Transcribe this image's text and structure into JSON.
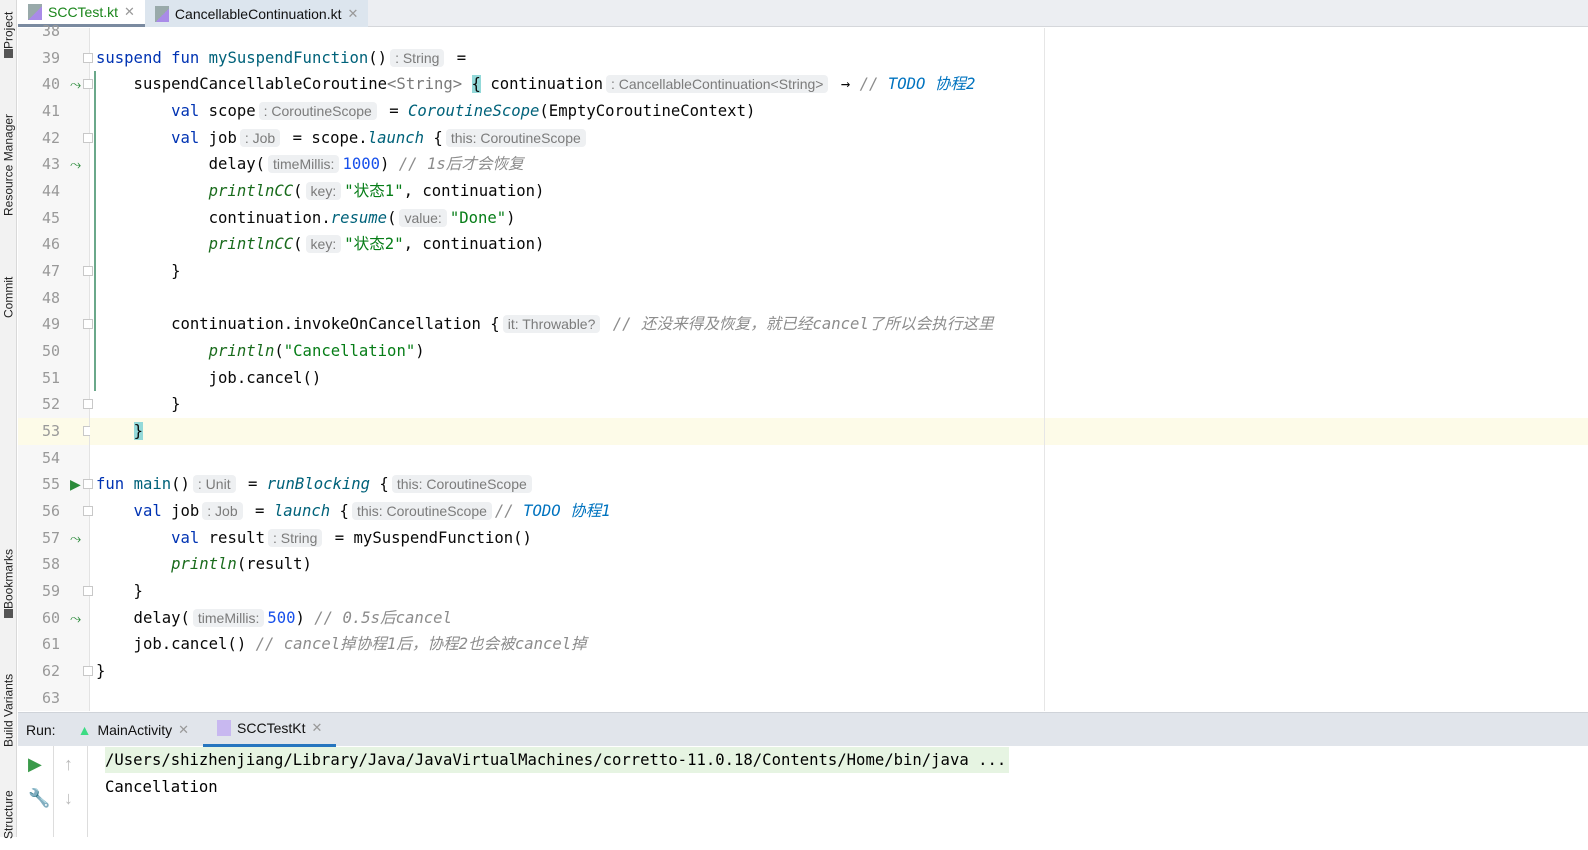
{
  "left_toolbar": [
    "Project",
    "Resource Manager",
    "Commit",
    "Bookmarks",
    "Build Variants",
    "Structure"
  ],
  "tabs": [
    {
      "label": "SCCTest.kt",
      "active": true
    },
    {
      "label": "CancellableContinuation.kt",
      "active": false
    }
  ],
  "current_line": 53,
  "lines": [
    {
      "n": "38",
      "tok": []
    },
    {
      "n": "39",
      "fold": true,
      "tok": [
        [
          "kw",
          "suspend fun "
        ],
        [
          "fd",
          "mySuspendFunction"
        ],
        [
          "",
          "()"
        ],
        [
          "hint",
          ": String"
        ],
        [
          "",
          " ="
        ]
      ]
    },
    {
      "n": "40",
      "icon": "suspend-call",
      "fold": true,
      "tok": [
        [
          "",
          "    suspendCancellableCoroutine"
        ],
        [
          "gen",
          "<String>"
        ],
        [
          "",
          " "
        ],
        [
          "br",
          "{"
        ],
        [
          "",
          " continuation"
        ],
        [
          "hint",
          ": CancellableContinuation<String>"
        ],
        [
          "",
          " → "
        ],
        [
          "cm",
          "// "
        ],
        [
          "todo",
          "TODO 协程2"
        ]
      ]
    },
    {
      "n": "41",
      "tok": [
        [
          "kw",
          "        val "
        ],
        [
          "",
          "scope"
        ],
        [
          "hint",
          ": CoroutineScope"
        ],
        [
          "",
          " = "
        ],
        [
          "ti",
          "CoroutineScope"
        ],
        [
          "",
          "(EmptyCoroutineContext)"
        ]
      ]
    },
    {
      "n": "42",
      "fold": true,
      "tok": [
        [
          "kw",
          "        val "
        ],
        [
          "",
          "job"
        ],
        [
          "hint",
          ": Job"
        ],
        [
          "",
          " = scope."
        ],
        [
          "ti",
          "launch"
        ],
        [
          "",
          " {"
        ],
        [
          "hint",
          "this: CoroutineScope"
        ]
      ]
    },
    {
      "n": "43",
      "icon": "suspend-call",
      "tok": [
        [
          "",
          "            delay("
        ],
        [
          "hint",
          "timeMillis:"
        ],
        [
          "nu",
          "1000"
        ],
        [
          "",
          ") "
        ],
        [
          "cm",
          "// 1s后才会恢复"
        ]
      ]
    },
    {
      "n": "44",
      "tok": [
        [
          "gi",
          "            printlnCC"
        ],
        [
          "",
          "("
        ],
        [
          "hint",
          "key:"
        ],
        [
          "st",
          "\"状态1\""
        ],
        [
          "",
          ", continuation)"
        ]
      ]
    },
    {
      "n": "45",
      "tok": [
        [
          "",
          "            continuation."
        ],
        [
          "ti",
          "resume"
        ],
        [
          "",
          "("
        ],
        [
          "hint",
          "value:"
        ],
        [
          "st",
          "\"Done\""
        ],
        [
          "",
          ")"
        ]
      ]
    },
    {
      "n": "46",
      "tok": [
        [
          "gi",
          "            printlnCC"
        ],
        [
          "",
          "("
        ],
        [
          "hint",
          "key:"
        ],
        [
          "st",
          "\"状态2\""
        ],
        [
          "",
          ", continuation)"
        ]
      ]
    },
    {
      "n": "47",
      "fold": true,
      "tok": [
        [
          "",
          "        }"
        ]
      ]
    },
    {
      "n": "48",
      "tok": []
    },
    {
      "n": "49",
      "fold": true,
      "tok": [
        [
          "",
          "        continuation.invokeOnCancellation {"
        ],
        [
          "hint",
          "it: Throwable?"
        ],
        [
          "cm",
          " // 还没来得及恢复，就已经cancel了所以会执行这里"
        ]
      ]
    },
    {
      "n": "50",
      "tok": [
        [
          "gi",
          "            println"
        ],
        [
          "",
          "("
        ],
        [
          "st",
          "\"Cancellation\""
        ],
        [
          "",
          ")"
        ]
      ]
    },
    {
      "n": "51",
      "tok": [
        [
          "",
          "            job.cancel()"
        ]
      ]
    },
    {
      "n": "52",
      "fold": true,
      "tok": [
        [
          "",
          "        }"
        ]
      ]
    },
    {
      "n": "53",
      "fold": true,
      "tok": [
        [
          "",
          "    "
        ],
        [
          "br",
          "}"
        ]
      ]
    },
    {
      "n": "54",
      "tok": []
    },
    {
      "n": "55",
      "icon": "run",
      "fold": true,
      "tok": [
        [
          "kw",
          "fun "
        ],
        [
          "fd",
          "main"
        ],
        [
          "",
          "()"
        ],
        [
          "hint",
          ": Unit"
        ],
        [
          "",
          " = "
        ],
        [
          "ti",
          "runBlocking"
        ],
        [
          "",
          " {"
        ],
        [
          "hint",
          "this: CoroutineScope"
        ]
      ]
    },
    {
      "n": "56",
      "fold": true,
      "tok": [
        [
          "kw",
          "    val "
        ],
        [
          "",
          "job"
        ],
        [
          "hint",
          ": Job"
        ],
        [
          "",
          " = "
        ],
        [
          "ti",
          "launch"
        ],
        [
          "",
          " {"
        ],
        [
          "hint",
          "this: CoroutineScope"
        ],
        [
          "cm",
          "// "
        ],
        [
          "todo",
          "TODO 协程1"
        ]
      ]
    },
    {
      "n": "57",
      "icon": "suspend-call",
      "tok": [
        [
          "kw",
          "        val "
        ],
        [
          "",
          "result"
        ],
        [
          "hint",
          ": String"
        ],
        [
          "",
          " = mySuspendFunction()"
        ]
      ]
    },
    {
      "n": "58",
      "tok": [
        [
          "gi",
          "        println"
        ],
        [
          "",
          "(result)"
        ]
      ]
    },
    {
      "n": "59",
      "fold": true,
      "tok": [
        [
          "",
          "    }"
        ]
      ]
    },
    {
      "n": "60",
      "icon": "suspend-call",
      "tok": [
        [
          "",
          "    delay("
        ],
        [
          "hint",
          "timeMillis:"
        ],
        [
          "nu",
          "500"
        ],
        [
          "",
          ") "
        ],
        [
          "cm",
          "// 0.5s后cancel"
        ]
      ]
    },
    {
      "n": "61",
      "tok": [
        [
          "",
          "    job.cancel() "
        ],
        [
          "cm",
          "// cancel掉协程1后，协程2也会被cancel掉"
        ]
      ]
    },
    {
      "n": "62",
      "fold": true,
      "tok": [
        [
          "",
          "}"
        ]
      ]
    },
    {
      "n": "63",
      "tok": []
    }
  ],
  "run_panel": {
    "label": "Run:",
    "tabs": [
      {
        "label": "MainActivity",
        "active": false
      },
      {
        "label": "SCCTestKt",
        "active": true
      }
    ],
    "output": [
      "/Users/shizhenjiang/Library/Java/JavaVirtualMachines/corretto-11.0.18/Contents/Home/bin/java ...",
      "Cancellation"
    ]
  }
}
